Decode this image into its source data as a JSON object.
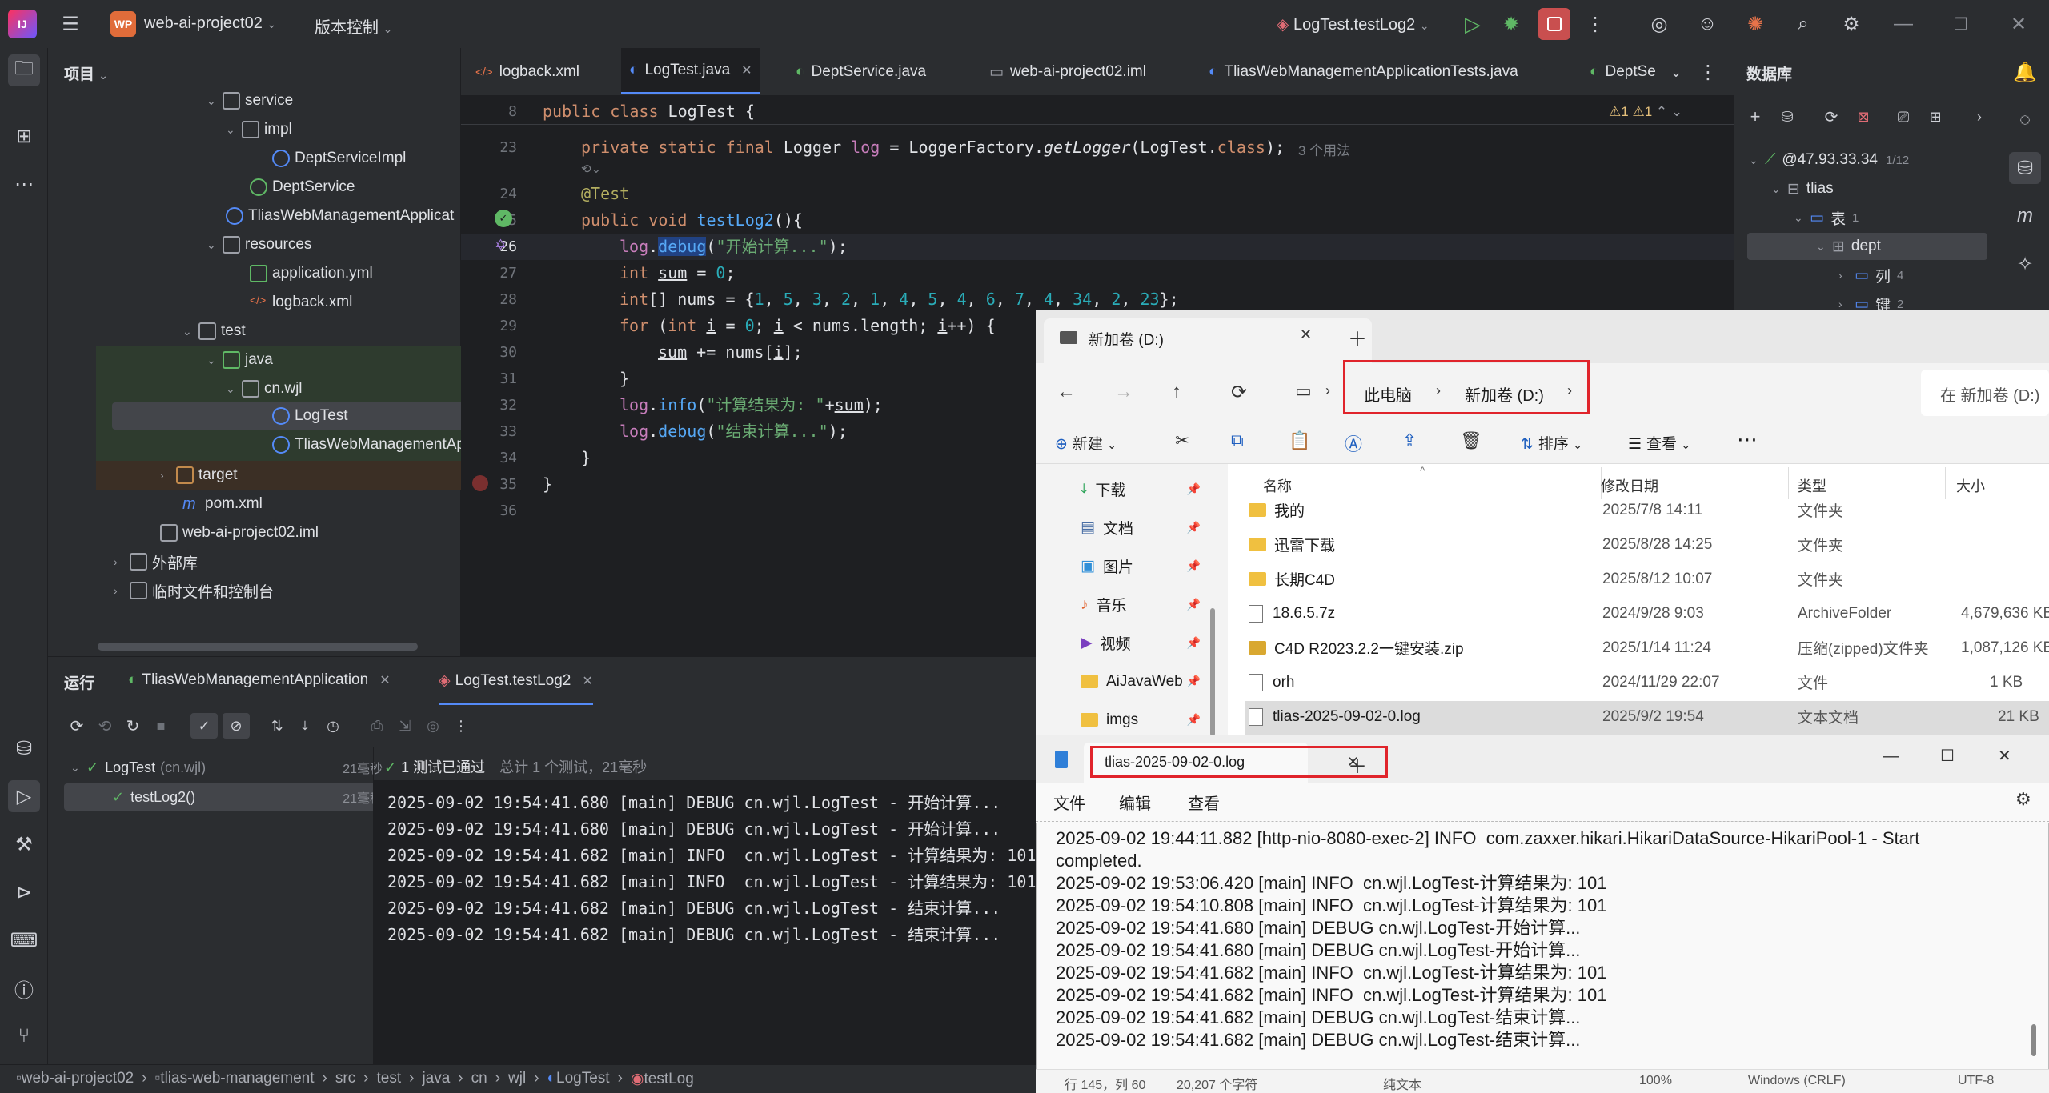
{
  "titlebar": {
    "project_badge": "WP",
    "project_name": "web-ai-project02",
    "vcs_label": "版本控制",
    "run_config": "LogTest.testLog2"
  },
  "project_panel": {
    "title": "项目",
    "tree": [
      {
        "label": "service",
        "kind": "package"
      },
      {
        "label": "impl",
        "kind": "package"
      },
      {
        "label": "DeptServiceImpl",
        "kind": "class"
      },
      {
        "label": "DeptService",
        "kind": "interface"
      },
      {
        "label": "TliasWebManagementApplicat",
        "kind": "class"
      },
      {
        "label": "resources",
        "kind": "folder"
      },
      {
        "label": "application.yml",
        "kind": "yml"
      },
      {
        "label": "logback.xml",
        "kind": "xml"
      },
      {
        "label": "test",
        "kind": "folder"
      },
      {
        "label": "java",
        "kind": "folder"
      },
      {
        "label": "cn.wjl",
        "kind": "package"
      },
      {
        "label": "LogTest",
        "kind": "class"
      },
      {
        "label": "TliasWebManagementApplicat",
        "kind": "class"
      },
      {
        "label": "target",
        "kind": "folder"
      },
      {
        "label": "pom.xml",
        "kind": "maven"
      },
      {
        "label": "web-ai-project02.iml",
        "kind": "iml"
      },
      {
        "label": "外部库",
        "kind": "lib"
      },
      {
        "label": "临时文件和控制台",
        "kind": "scratch"
      }
    ]
  },
  "editor": {
    "tabs": [
      {
        "label": "logback.xml"
      },
      {
        "label": "LogTest.java"
      },
      {
        "label": "DeptService.java"
      },
      {
        "label": "web-ai-project02.iml"
      },
      {
        "label": "TliasWebManagementApplicationTests.java"
      },
      {
        "label": "DeptSe"
      }
    ],
    "sticky_line_no": "8",
    "sticky_code": "public class LogTest {",
    "warnings": "1",
    "weak_warnings": "1",
    "usages_hint": "3 个用法",
    "line_numbers": [
      "23",
      "24",
      "25",
      "26",
      "27",
      "28",
      "29",
      "30",
      "31",
      "32",
      "33",
      "34",
      "35",
      "36"
    ],
    "code": {
      "l23": "private static final Logger log = LoggerFactory.getLogger(LogTest.class);",
      "l24": "@Test",
      "l25": "public void testLog2(){",
      "l26": "log.debug(\"开始计算...\");",
      "l27": "int sum = 0;",
      "l28": "int[] nums = {1, 5, 3, 2, 1, 4, 5, 4, 6, 7, 4, 34, 2, 23};",
      "l29": "for (int i = 0; i < nums.length; i++) {",
      "l30": "sum += nums[i];",
      "l31": "}",
      "l32": "log.info(\"计算结果为: \"+sum);",
      "l33": "log.debug(\"结束计算...\");",
      "l34": "}",
      "l35": "}"
    }
  },
  "db_panel": {
    "title": "数据库",
    "connection": "@47.93.33.34",
    "connection_count": "1/12",
    "schema": "tlias",
    "tables_label": "表",
    "tables_count": "1",
    "table": "dept",
    "columns_label": "列",
    "columns_count": "4",
    "keys_label": "键",
    "keys_count": "2"
  },
  "run_panel": {
    "title": "运行",
    "tabs": [
      {
        "label": "TliasWebManagementApplication"
      },
      {
        "label": "LogTest.testLog2"
      }
    ],
    "tests": [
      {
        "name": "LogTest",
        "pkg": "(cn.wjl)",
        "time": "21毫秒"
      },
      {
        "name": "testLog2()",
        "pkg": "",
        "time": "21毫秒"
      }
    ],
    "result_pass": "1 测试已通过",
    "result_summary": "总计 1 个测试，21毫秒",
    "console": [
      "2025-09-02 19:54:41.680 [main] DEBUG cn.wjl.LogTest - 开始计算...",
      "2025-09-02 19:54:41.680 [main] DEBUG cn.wjl.LogTest - 开始计算...",
      "2025-09-02 19:54:41.682 [main] INFO  cn.wjl.LogTest - 计算结果为: 101",
      "2025-09-02 19:54:41.682 [main] INFO  cn.wjl.LogTest - 计算结果为: 101",
      "2025-09-02 19:54:41.682 [main] DEBUG cn.wjl.LogTest - 结束计算...",
      "2025-09-02 19:54:41.682 [main] DEBUG cn.wjl.LogTest - 结束计算..."
    ]
  },
  "statusbar": {
    "crumbs": [
      "web-ai-project02",
      "tlias-web-management",
      "src",
      "test",
      "java",
      "cn",
      "wjl",
      "LogTest",
      "testLog"
    ]
  },
  "explorer": {
    "tab_title": "新加卷 (D:)",
    "path": [
      "此电脑",
      "新加卷 (D:)"
    ],
    "search_placeholder": "在 新加卷 (D:)",
    "toolbar": {
      "new": "新建",
      "sort": "排序",
      "view": "查看"
    },
    "sidebar": [
      "下载",
      "文档",
      "图片",
      "音乐",
      "视频",
      "AiJavaWeb",
      "imgs"
    ],
    "columns": {
      "name": "名称",
      "date": "修改日期",
      "type": "类型",
      "size": "大小"
    },
    "files": [
      {
        "name": "我的",
        "date": "2025/7/8 14:11",
        "type": "文件夹",
        "size": "",
        "kind": "folder"
      },
      {
        "name": "迅雷下载",
        "date": "2025/8/28 14:25",
        "type": "文件夹",
        "size": "",
        "kind": "folder"
      },
      {
        "name": "长期C4D",
        "date": "2025/8/12 10:07",
        "type": "文件夹",
        "size": "",
        "kind": "folder"
      },
      {
        "name": "18.6.5.7z",
        "date": "2024/9/28 9:03",
        "type": "ArchiveFolder",
        "size": "4,679,636 KB",
        "kind": "file"
      },
      {
        "name": "C4D R2023.2.2一键安装.zip",
        "date": "2025/1/14 11:24",
        "type": "压缩(zipped)文件夹",
        "size": "1,087,126 KB",
        "kind": "zip"
      },
      {
        "name": "orh",
        "date": "2024/11/29 22:07",
        "type": "文件",
        "size": "1 KB",
        "kind": "file"
      },
      {
        "name": "tlias-2025-09-02-0.log",
        "date": "2025/9/2 19:54",
        "type": "文本文档",
        "size": "21 KB",
        "kind": "file"
      }
    ]
  },
  "notepad": {
    "tab_title": "tlias-2025-09-02-0.log",
    "menu": [
      "文件",
      "编辑",
      "查看"
    ],
    "lines": [
      "2025-09-02 19:44:11.882 [http-nio-8080-exec-2] INFO  com.zaxxer.hikari.HikariDataSource-HikariPool-1 - Start",
      "completed.",
      "2025-09-02 19:53:06.420 [main] INFO  cn.wjl.LogTest-计算结果为: 101",
      "2025-09-02 19:54:10.808 [main] INFO  cn.wjl.LogTest-计算结果为: 101",
      "2025-09-02 19:54:41.680 [main] DEBUG cn.wjl.LogTest-开始计算...",
      "2025-09-02 19:54:41.680 [main] DEBUG cn.wjl.LogTest-开始计算...",
      "2025-09-02 19:54:41.682 [main] INFO  cn.wjl.LogTest-计算结果为: 101",
      "2025-09-02 19:54:41.682 [main] INFO  cn.wjl.LogTest-计算结果为: 101",
      "2025-09-02 19:54:41.682 [main] DEBUG cn.wjl.LogTest-结束计算...",
      "2025-09-02 19:54:41.682 [main] DEBUG cn.wjl.LogTest-结束计算..."
    ],
    "status": {
      "position": "行 145，列 60",
      "chars": "20,207 个字符",
      "format": "纯文本",
      "zoom": "100%",
      "eol": "Windows (CRLF)",
      "encoding": "UTF-8"
    }
  }
}
